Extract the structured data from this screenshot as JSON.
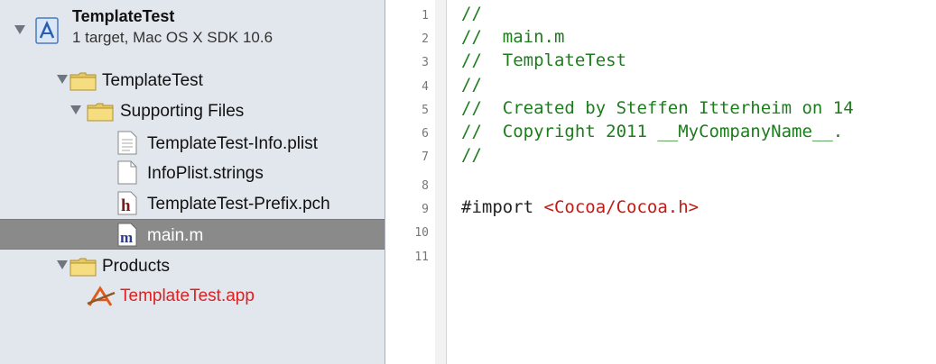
{
  "navigator": {
    "project": {
      "name": "TemplateTest",
      "subtitle": "1 target, Mac OS X SDK 10.6"
    },
    "items": [
      {
        "label": "TemplateTest",
        "kind": "group",
        "icon": "folder-icon"
      },
      {
        "label": "Supporting Files",
        "kind": "group",
        "icon": "folder-icon"
      },
      {
        "label": "TemplateTest-Info.plist",
        "kind": "file",
        "icon": "plist-file-icon"
      },
      {
        "label": "InfoPlist.strings",
        "kind": "file",
        "icon": "strings-file-icon"
      },
      {
        "label": "TemplateTest-Prefix.pch",
        "kind": "file",
        "icon": "header-file-icon",
        "icon_letter": "h"
      },
      {
        "label": "main.m",
        "kind": "file",
        "icon": "objc-source-file-icon",
        "icon_letter": "m",
        "selected": true
      },
      {
        "label": "Products",
        "kind": "group",
        "icon": "folder-icon"
      },
      {
        "label": "TemplateTest.app",
        "kind": "product",
        "icon": "app-icon",
        "missing": true
      }
    ]
  },
  "editor": {
    "line_numbers": [
      "1",
      "2",
      "3",
      "4",
      "5",
      "6",
      "7",
      "8",
      "9",
      "10",
      "11"
    ],
    "lines": [
      {
        "comment": "//"
      },
      {
        "comment": "//  main.m"
      },
      {
        "comment": "//  TemplateTest"
      },
      {
        "comment": "//"
      },
      {
        "comment": "//  Created by Steffen Itterheim on 14"
      },
      {
        "comment": "//  Copyright 2011 __MyCompanyName__."
      },
      {
        "comment": "//"
      },
      {
        "comment": ""
      },
      {
        "keyword": "#import ",
        "string": "<Cocoa/Cocoa.h>"
      },
      {
        "comment": ""
      },
      {
        "comment": ""
      }
    ]
  },
  "colors": {
    "comment": "#1d7d1d",
    "string": "#c41a16",
    "selection": "#8a8a8a",
    "missing_product": "#e02020",
    "navigator_bg": "#e2e7ed"
  }
}
